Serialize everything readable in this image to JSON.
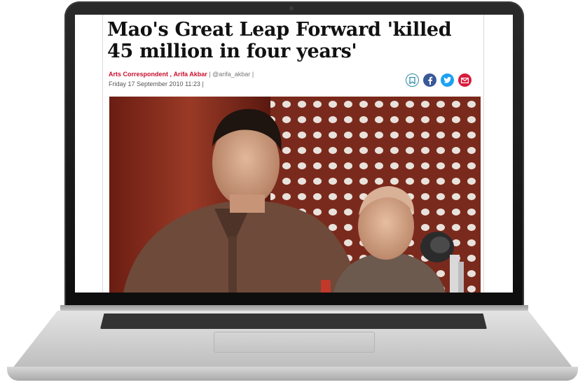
{
  "article": {
    "headline": "Mao's Great Leap Forward 'killed 45 million in four years'",
    "byline": {
      "role": "Arts Correspondent",
      "separator": ",",
      "author": "Arifa Akbar",
      "divider": "|",
      "handle": "@arifa_akbar",
      "trailing_divider": "|"
    },
    "date": "Friday 17 September 2010 11:23",
    "date_divider": "|"
  },
  "share_buttons": [
    {
      "name": "bookmark",
      "icon": "bookmark-icon",
      "color": "#2c8aa6"
    },
    {
      "name": "facebook",
      "icon": "facebook-icon",
      "color": "#3b5998"
    },
    {
      "name": "twitter",
      "icon": "twitter-icon",
      "color": "#1da1f2"
    },
    {
      "name": "email",
      "icon": "mail-icon",
      "color": "#d81b3b"
    }
  ],
  "colors": {
    "accent_red": "#c8102e",
    "headline": "#111111"
  }
}
